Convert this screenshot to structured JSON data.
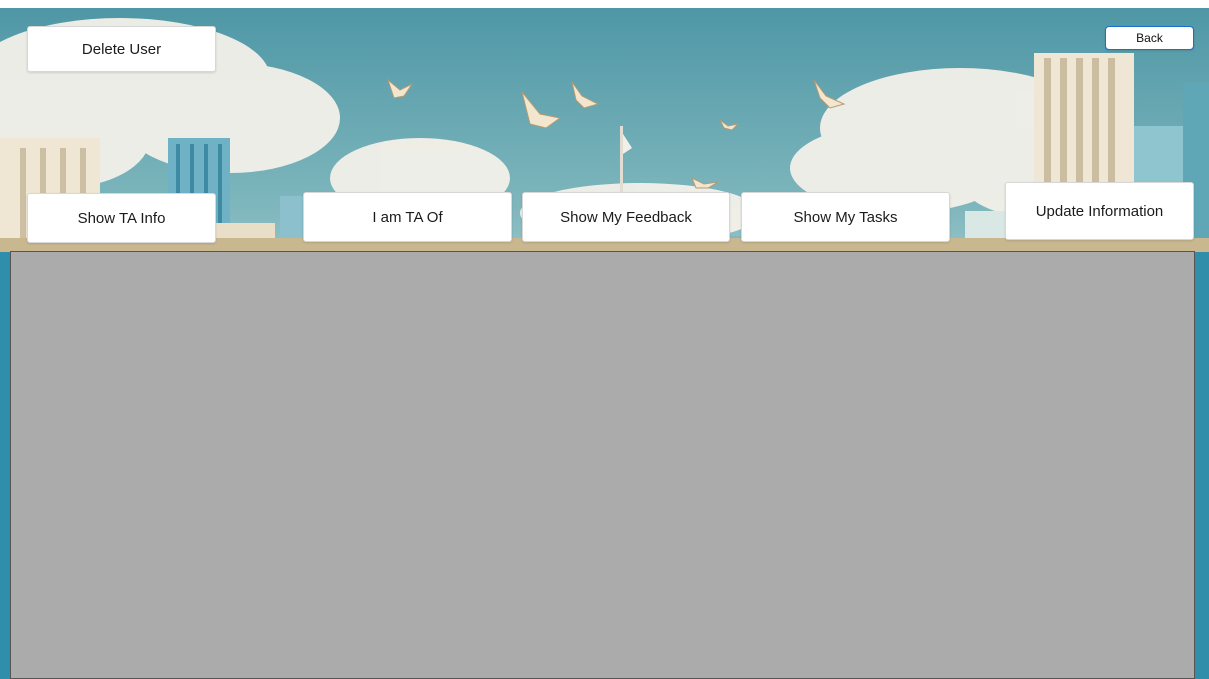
{
  "buttons": {
    "delete_user": "Delete User",
    "back": "Back",
    "show_ta_info": "Show TA Info",
    "i_am_ta_of": "I am TA Of",
    "show_my_feedback": "Show My Feedback",
    "show_my_tasks": "Show My Tasks",
    "update_information": "Update Information"
  },
  "colors": {
    "sky": "#4f97a6",
    "panel": "#ababab",
    "back_border": "#1a6fd0"
  }
}
